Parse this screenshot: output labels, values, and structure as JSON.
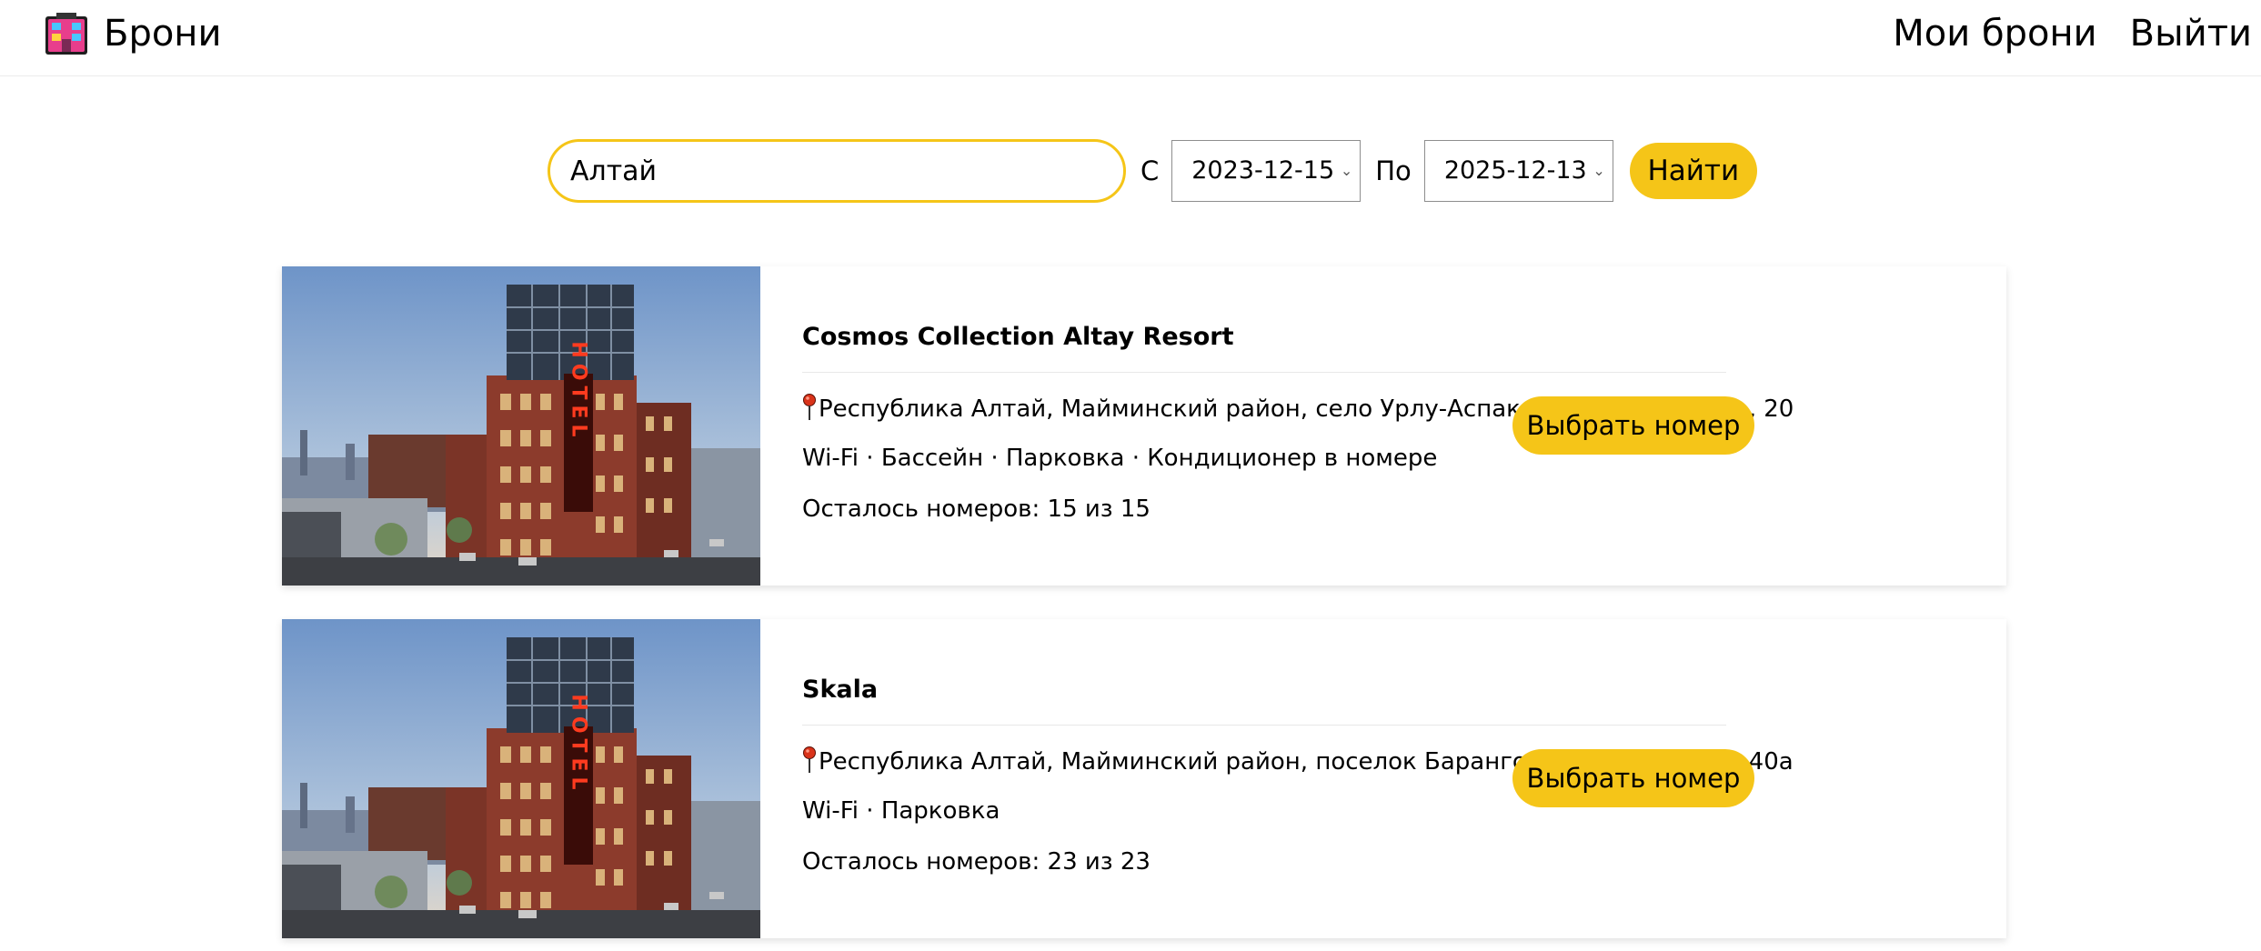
{
  "header": {
    "brand_icon": "hotel-building-emoji-icon",
    "brand_label": "Брони",
    "nav": {
      "my_bookings": "Мои брони",
      "logout": "Выйти"
    }
  },
  "search": {
    "query": "Алтай",
    "from_label": "С",
    "from_date": "2023-12-15",
    "to_label": "По",
    "to_date": "2025-12-13",
    "submit_label": "Найти"
  },
  "colors": {
    "accent": "#f5c518",
    "pin": "#d9331a"
  },
  "hotels": [
    {
      "name": "Cosmos Collection Altay Resort",
      "address_icon": "map-pin-icon",
      "address": "Республика Алтай, Майминский район, село Урлу-Аспак, Лесхозная улица, 20",
      "amenities": "Wi-Fi · Бассейн · Парковка · Кондиционер в номере",
      "rooms_left": "Осталось номеров: 15 из 15",
      "button_label": "Выбрать номер",
      "image_sign": "HOTEL"
    },
    {
      "name": "Skala",
      "address_icon": "map-pin-icon",
      "address": "Республика Алтай, Майминский район, поселок Барангол, Чуйская улица 40а",
      "amenities": "Wi-Fi · Парковка",
      "rooms_left": "Осталось номеров: 23 из 23",
      "button_label": "Выбрать номер",
      "image_sign": "HOTEL"
    }
  ]
}
